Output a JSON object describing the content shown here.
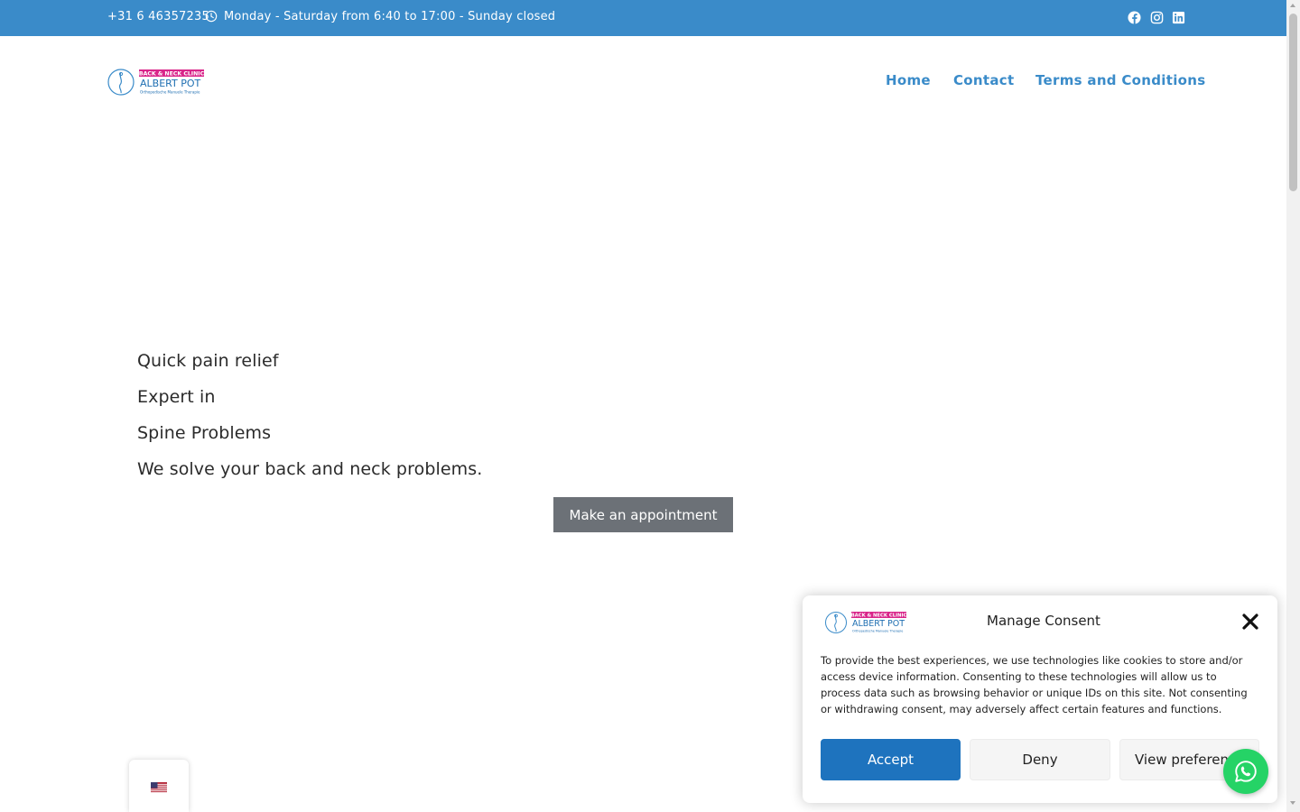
{
  "topbar": {
    "phone": "+31 6 46357235",
    "hours": "Monday - Saturday from 6:40 to 17:00 - Sunday closed",
    "social": [
      "facebook-icon",
      "instagram-icon",
      "linkedin-icon"
    ],
    "background": "#3a8bc9"
  },
  "logo": {
    "tagline": "BACK & NECK CLINIC",
    "name": "ALBERT POT",
    "subtitle": "Orthopedische Manuele Therapie"
  },
  "nav": {
    "items": [
      "Home",
      "Contact",
      "Terms and Conditions"
    ],
    "color": "#3a8bc9"
  },
  "hero": {
    "lines": [
      "Quick pain relief",
      "Expert in",
      "Spine Problems",
      "We solve your back and neck problems."
    ],
    "button_label": "Make an appointment"
  },
  "language": {
    "current": "flag-us-icon"
  },
  "consent": {
    "title": "Manage Consent",
    "text": "To provide the best experiences, we use technologies like cookies to store and/or access device information. Consenting to these technologies will allow us to process data such as browsing behavior or unique IDs on this site. Not consenting or withdrawing consent, may adversely affect certain features and functions.",
    "accept_label": "Accept",
    "deny_label": "Deny",
    "prefs_label": "View preferences",
    "accent": "#1e73be"
  },
  "whatsapp": {
    "icon": "whatsapp-icon",
    "color": "#25d366"
  }
}
